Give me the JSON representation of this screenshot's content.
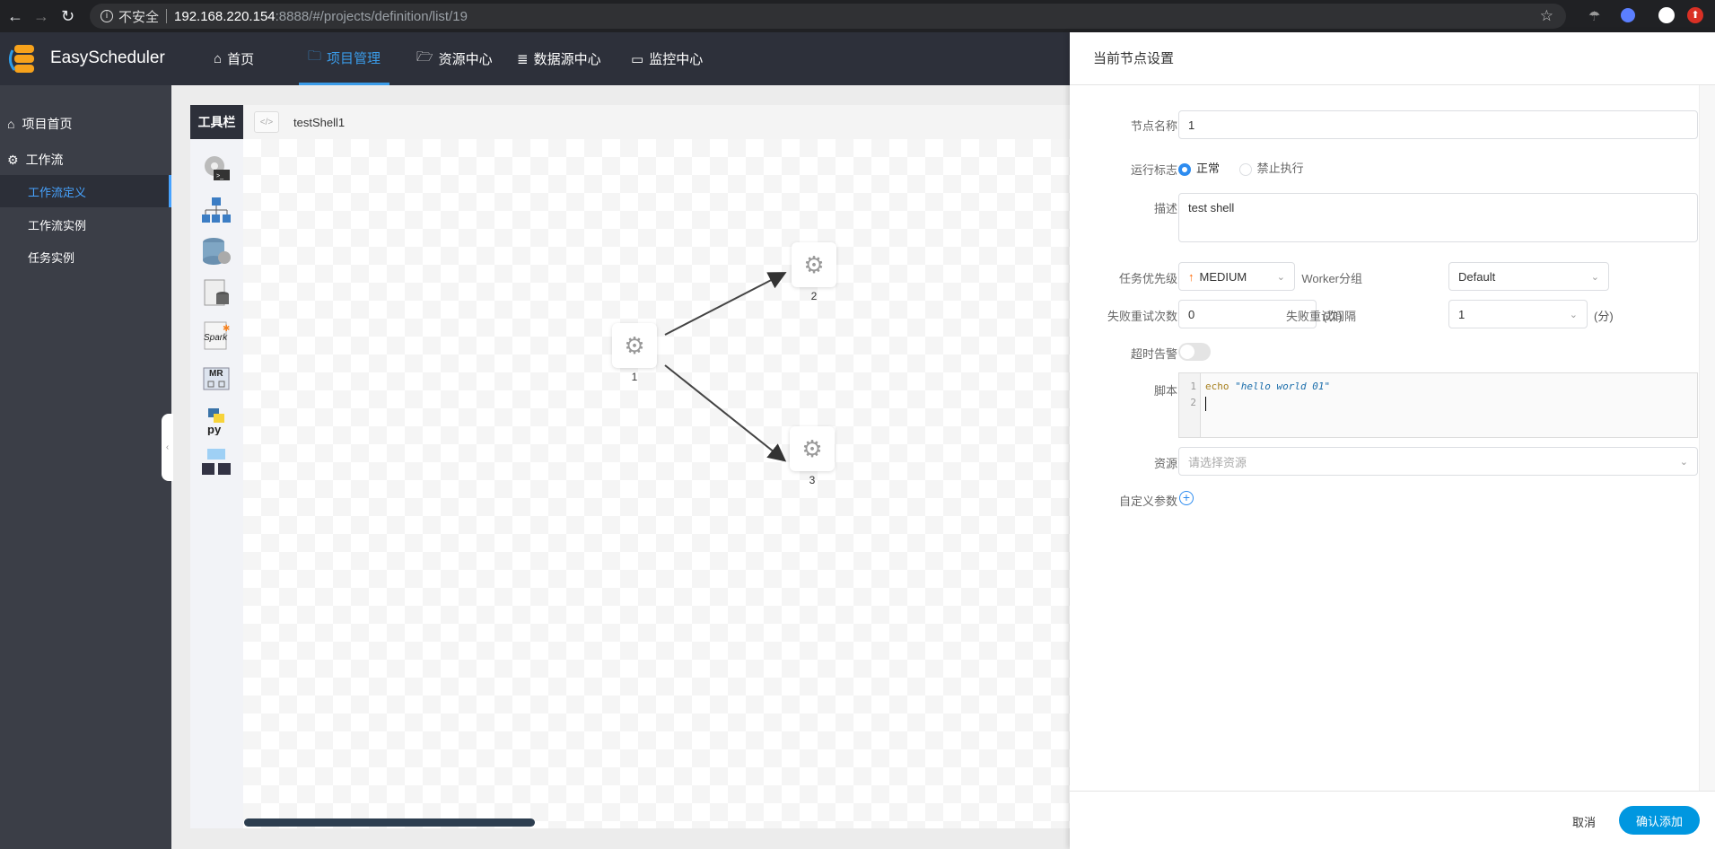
{
  "browser": {
    "security": "不安全",
    "url_host": "192.168.220.154",
    "url_path": ":8888/#/projects/definition/list/19"
  },
  "app": {
    "name": "EasyScheduler",
    "nav": [
      {
        "label": "首页",
        "icon": "home-icon"
      },
      {
        "label": "项目管理",
        "icon": "project-icon",
        "active": true
      },
      {
        "label": "资源中心",
        "icon": "folder-icon"
      },
      {
        "label": "数据源中心",
        "icon": "database-icon"
      },
      {
        "label": "监控中心",
        "icon": "monitor-icon"
      }
    ]
  },
  "sidebar": {
    "items": [
      {
        "label": "项目首页",
        "icon": "home-icon"
      },
      {
        "label": "工作流",
        "icon": "gear-icon"
      },
      {
        "label": "工作流定义",
        "active": true
      },
      {
        "label": "工作流实例"
      },
      {
        "label": "任务实例"
      }
    ]
  },
  "toolbar": {
    "label": "工具栏",
    "tools": [
      "shell",
      "sub-process",
      "procedure",
      "sql",
      "spark",
      "mr",
      "python",
      "dependent"
    ]
  },
  "workflow": {
    "name": "testShell1",
    "nodes": [
      {
        "label": "1"
      },
      {
        "label": "2"
      },
      {
        "label": "3"
      }
    ],
    "edges": [
      [
        "1",
        "2"
      ],
      [
        "1",
        "3"
      ]
    ]
  },
  "panel": {
    "title": "当前节点设置",
    "node_name": {
      "label": "节点名称",
      "value": "1"
    },
    "run_flag": {
      "label": "运行标志",
      "options": [
        "正常",
        "禁止执行"
      ],
      "selected": "正常"
    },
    "description": {
      "label": "描述",
      "value": "test shell"
    },
    "priority": {
      "label": "任务优先级",
      "value": "MEDIUM",
      "color": "#ff6600"
    },
    "worker_group": {
      "label": "Worker分组",
      "value": "Default"
    },
    "retry_times": {
      "label": "失败重试次数",
      "value": "0",
      "unit": "(次)"
    },
    "retry_interval": {
      "label": "失败重试间隔",
      "value": "1",
      "unit": "(分)"
    },
    "timeout_alarm": {
      "label": "超时告警",
      "enabled": false
    },
    "script": {
      "label": "脚本",
      "lines": [
        "1",
        "2"
      ],
      "keyword": "echo",
      "string": "\"hello world 01\""
    },
    "resources": {
      "label": "资源",
      "placeholder": "请选择资源"
    },
    "custom_params": {
      "label": "自定义参数"
    },
    "cancel": "取消",
    "confirm": "确认添加",
    "accent": "#0097e0"
  }
}
